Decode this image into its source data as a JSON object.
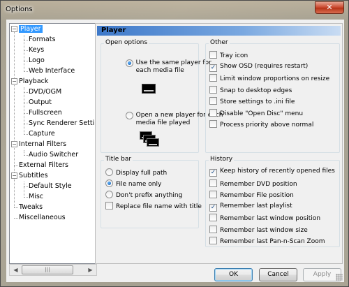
{
  "window": {
    "title": "Options",
    "close_glyph": "✕"
  },
  "tree": {
    "items": [
      {
        "label": "Player",
        "selected": true,
        "expanded": true
      },
      {
        "label": "Formats"
      },
      {
        "label": "Keys"
      },
      {
        "label": "Logo"
      },
      {
        "label": "Web Interface"
      },
      {
        "label": "Playback",
        "expanded": true
      },
      {
        "label": "DVD/OGM"
      },
      {
        "label": "Output"
      },
      {
        "label": "Fullscreen"
      },
      {
        "label": "Sync Renderer Setti"
      },
      {
        "label": "Capture"
      },
      {
        "label": "Internal Filters",
        "expanded": true
      },
      {
        "label": "Audio Switcher"
      },
      {
        "label": "External Filters"
      },
      {
        "label": "Subtitles",
        "expanded": true
      },
      {
        "label": "Default Style"
      },
      {
        "label": "Misc"
      },
      {
        "label": "Tweaks"
      },
      {
        "label": "Miscellaneous"
      }
    ],
    "expander_glyph": "−"
  },
  "panel": {
    "header": "Player",
    "open_options": {
      "title": "Open options",
      "same_player": "Use the same player for\neach media file",
      "new_player": "Open a new player for each\nmedia file played",
      "selected": "same_player"
    },
    "title_bar": {
      "title": "Title bar",
      "full_path": "Display full path",
      "file_name_only": "File name only",
      "no_prefix": "Don't prefix anything",
      "replace_with_title": "Replace file name with title",
      "selected": "file_name_only",
      "replace_checked": false
    },
    "other": {
      "title": "Other",
      "items": [
        {
          "label": "Tray icon",
          "checked": false
        },
        {
          "label": "Show OSD (requires restart)",
          "checked": true
        },
        {
          "label": "Limit window proportions on resize",
          "checked": false
        },
        {
          "label": "Snap to desktop edges",
          "checked": false
        },
        {
          "label": "Store settings to .ini file",
          "checked": false
        },
        {
          "label": "Disable \"Open Disc\" menu",
          "checked": false
        },
        {
          "label": "Process priority above normal",
          "checked": false
        }
      ]
    },
    "history": {
      "title": "History",
      "items": [
        {
          "label": "Keep history of recently opened files",
          "checked": true
        },
        {
          "label": "Remember DVD position",
          "checked": false
        },
        {
          "label": "Remember File position",
          "checked": false
        },
        {
          "label": "Remember last playlist",
          "checked": true
        },
        {
          "label": "Remember last window position",
          "checked": false
        },
        {
          "label": "Remember last window size",
          "checked": false
        },
        {
          "label": "Remember last Pan-n-Scan Zoom",
          "checked": false
        }
      ]
    }
  },
  "buttons": {
    "ok": "OK",
    "cancel": "Cancel",
    "apply": "Apply"
  },
  "check_glyph": "✓"
}
